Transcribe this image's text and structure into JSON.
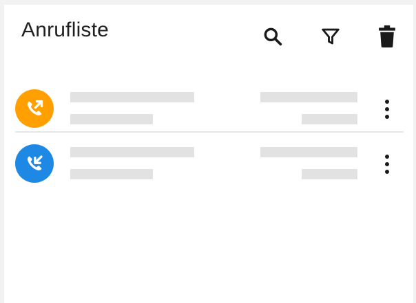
{
  "header": {
    "title": "Anrufliste",
    "actions": [
      {
        "name": "search",
        "icon": "search-icon"
      },
      {
        "name": "filter",
        "icon": "filter-icon"
      },
      {
        "name": "delete",
        "icon": "trash-icon"
      }
    ]
  },
  "calls": [
    {
      "type": "outgoing",
      "icon": "outgoing-call-icon",
      "color": "#ffa000",
      "name": "",
      "number": "",
      "time": "",
      "duration": ""
    },
    {
      "type": "incoming",
      "icon": "incoming-call-icon",
      "color": "#1e88e5",
      "name": "",
      "number": "",
      "time": "",
      "duration": ""
    }
  ],
  "colors": {
    "icon": "#1a1a1a",
    "placeholder": "#e2e2e2",
    "divider": "#e6e6e6"
  }
}
